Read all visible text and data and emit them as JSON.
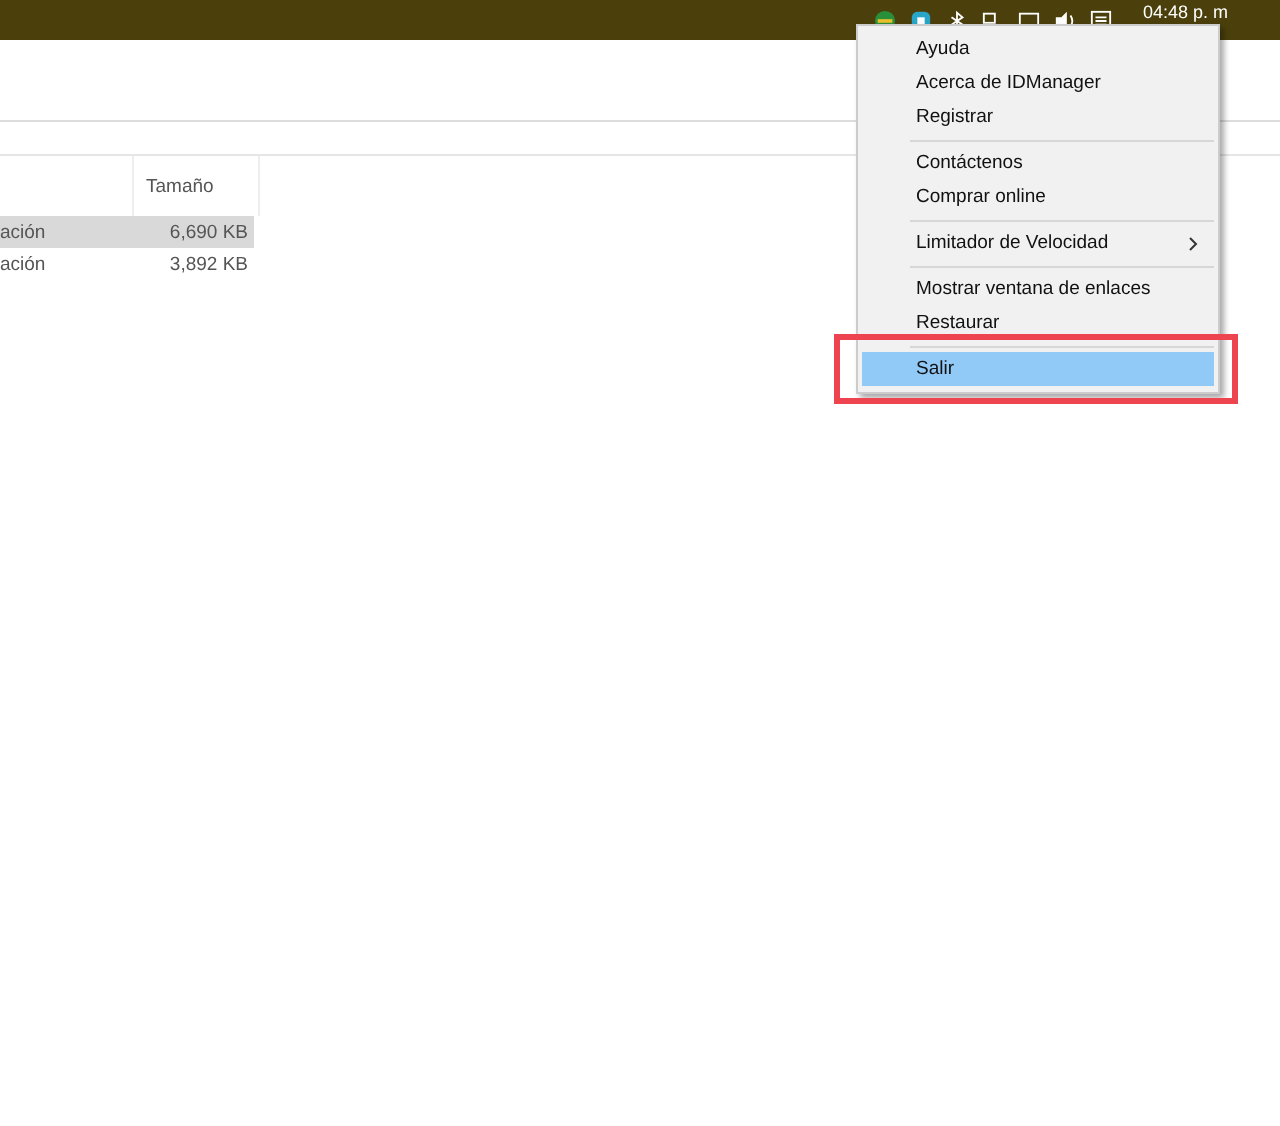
{
  "taskbar": {
    "clock": "04:48 p. m"
  },
  "file_list": {
    "columns": [
      {
        "label": "Tamaño"
      }
    ],
    "rows": [
      {
        "name": "ación",
        "size": "6,690 KB",
        "selected": true
      },
      {
        "name": "ación",
        "size": "3,892 KB",
        "selected": false
      }
    ]
  },
  "context_menu": {
    "items": [
      {
        "kind": "item",
        "label": "Ayuda",
        "selected": false
      },
      {
        "kind": "item",
        "label": "Acerca de IDManager",
        "selected": false
      },
      {
        "kind": "item",
        "label": "Registrar",
        "selected": false
      },
      {
        "kind": "separator"
      },
      {
        "kind": "item",
        "label": "Contáctenos",
        "selected": false
      },
      {
        "kind": "item",
        "label": "Comprar online",
        "selected": false
      },
      {
        "kind": "separator"
      },
      {
        "kind": "item",
        "label": "Limitador de Velocidad",
        "selected": false,
        "submenu": true
      },
      {
        "kind": "separator"
      },
      {
        "kind": "item",
        "label": "Mostrar ventana de enlaces",
        "selected": false
      },
      {
        "kind": "item",
        "label": "Restaurar",
        "selected": false
      },
      {
        "kind": "separator"
      },
      {
        "kind": "item",
        "label": "Salir",
        "selected": true,
        "highlighted": true
      }
    ]
  }
}
